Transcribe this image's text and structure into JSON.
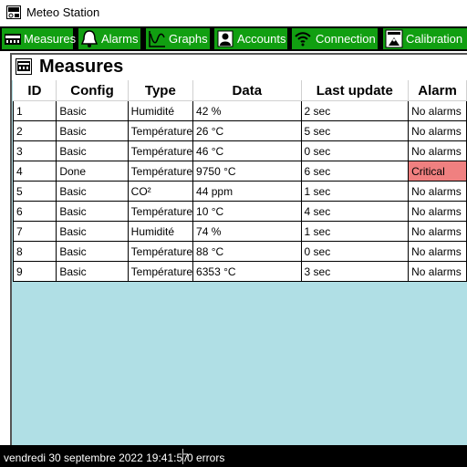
{
  "window": {
    "title": "Meteo Station",
    "icon": "weather-station-icon"
  },
  "toolbar": {
    "items": [
      {
        "label": "Measures",
        "icon": "measures-icon"
      },
      {
        "label": "Alarms",
        "icon": "bell-icon"
      },
      {
        "label": "Graphs",
        "icon": "graph-icon"
      },
      {
        "label": "Accounts",
        "icon": "account-icon"
      },
      {
        "label": "Connection",
        "icon": "wifi-icon"
      },
      {
        "label": "Calibration",
        "icon": "calibration-icon"
      }
    ],
    "colors": {
      "button": "#119f11",
      "background": "#000000",
      "text": "#ffffff"
    }
  },
  "page": {
    "title": "Measures",
    "icon": "measures-icon",
    "background": "#b0dfe5"
  },
  "table": {
    "columns": [
      "ID",
      "Config",
      "Type",
      "Data",
      "Last update",
      "Alarm"
    ],
    "rows": [
      [
        "1",
        "Basic",
        "Humidité",
        "42 %",
        "2 sec",
        "No alarms"
      ],
      [
        "2",
        "Basic",
        "Température",
        "26 °C",
        "5 sec",
        "No alarms"
      ],
      [
        "3",
        "Basic",
        "Température",
        "46 °C",
        "0 sec",
        "No alarms"
      ],
      [
        "4",
        "Done",
        "Température",
        "9750 °C",
        "6 sec",
        "Critical"
      ],
      [
        "5",
        "Basic",
        "CO²",
        "44 ppm",
        "1 sec",
        "No alarms"
      ],
      [
        "6",
        "Basic",
        "Température",
        "10 °C",
        "4 sec",
        "No alarms"
      ],
      [
        "7",
        "Basic",
        "Humidité",
        "74 %",
        "1 sec",
        "No alarms"
      ],
      [
        "8",
        "Basic",
        "Température",
        "88 °C",
        "0 sec",
        "No alarms"
      ],
      [
        "9",
        "Basic",
        "Température",
        "6353 °C",
        "3 sec",
        "No alarms"
      ]
    ],
    "critical_color": "#f08080"
  },
  "status": {
    "datetime": "vendredi 30 septembre 2022 19:41:57",
    "errors": "0 errors"
  }
}
